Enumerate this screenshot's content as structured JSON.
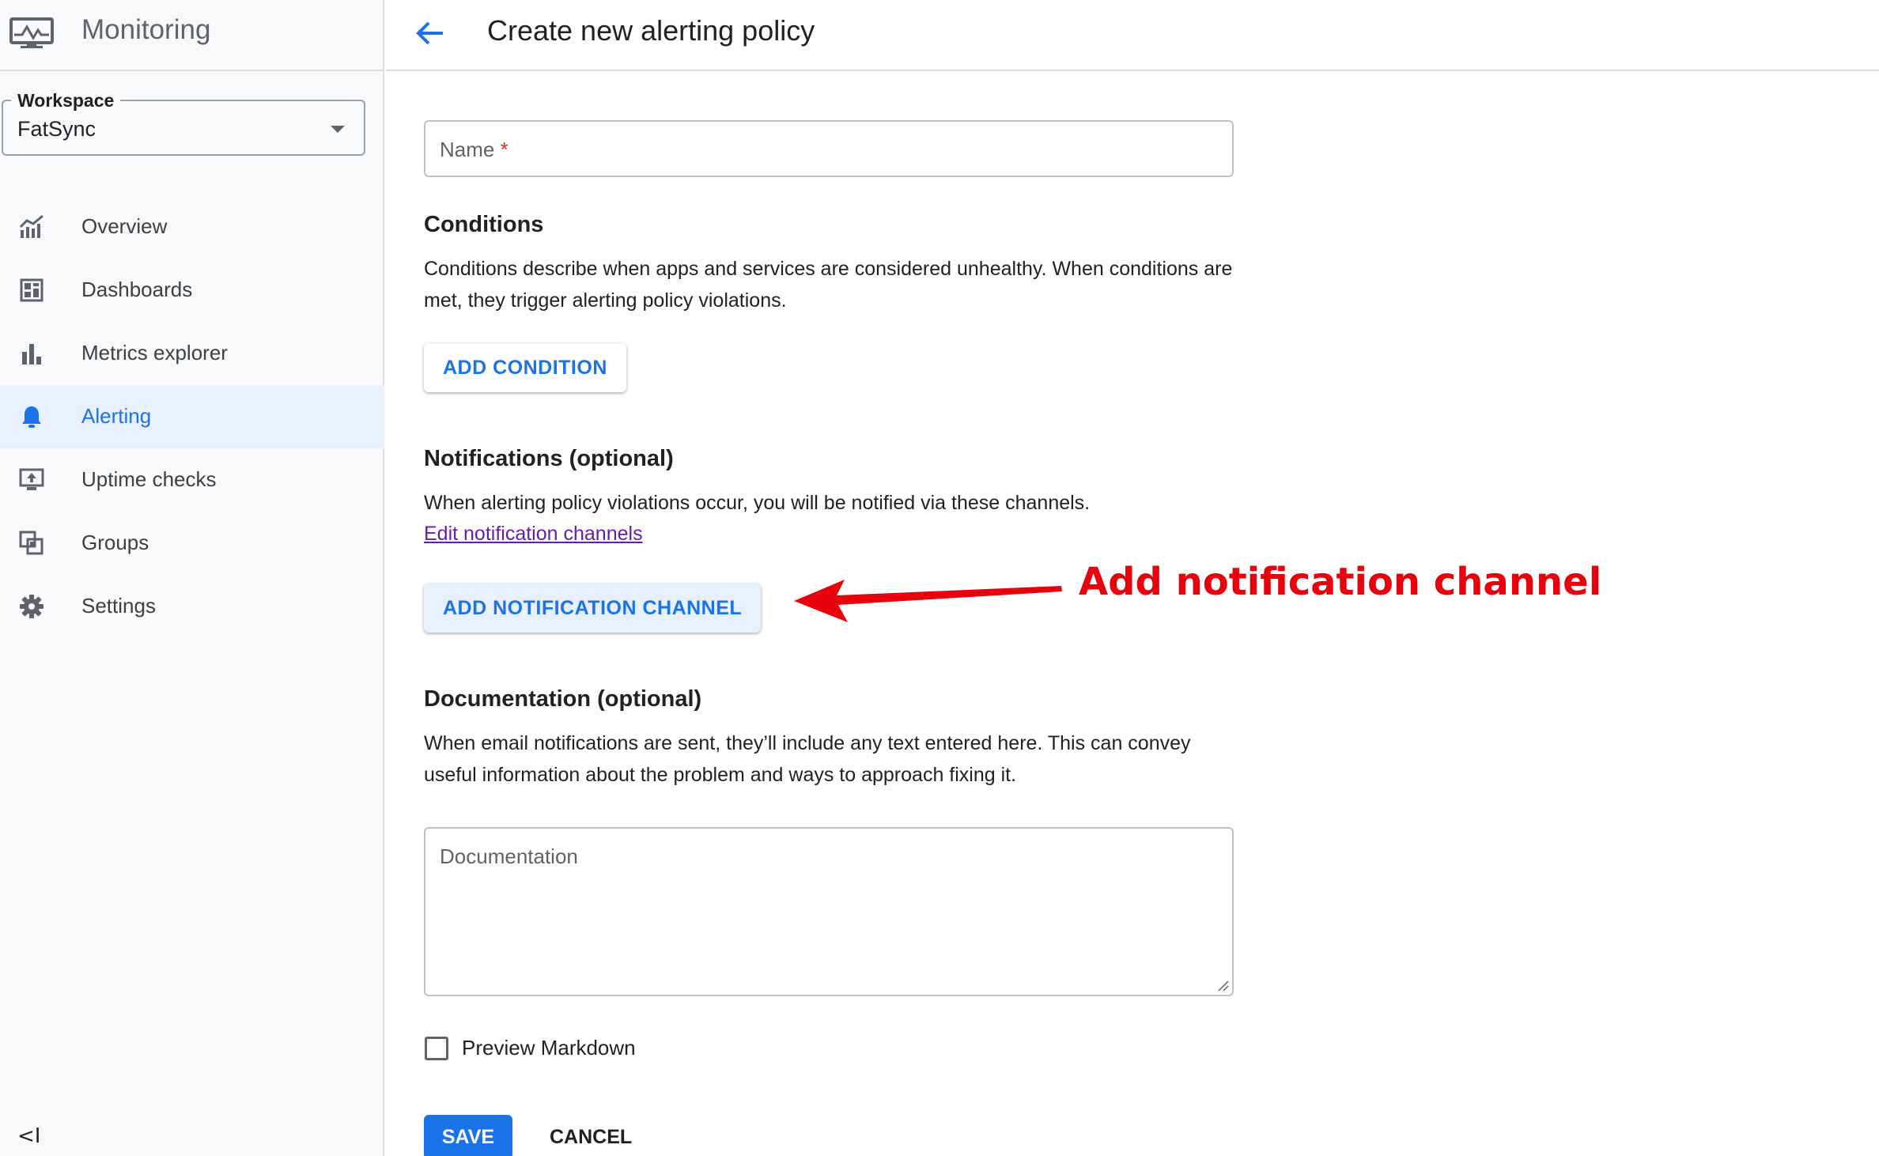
{
  "app": {
    "title": "Monitoring",
    "logo_icon": "monitor-icon"
  },
  "workspace": {
    "label": "Workspace",
    "value": "FatSync"
  },
  "sidebar": {
    "items": [
      {
        "label": "Overview",
        "icon": "overview-chart-icon",
        "active": false
      },
      {
        "label": "Dashboards",
        "icon": "dashboard-icon",
        "active": false
      },
      {
        "label": "Metrics explorer",
        "icon": "bar-chart-icon",
        "active": false
      },
      {
        "label": "Alerting",
        "icon": "bell-icon",
        "active": true
      },
      {
        "label": "Uptime checks",
        "icon": "uptime-monitor-icon",
        "active": false
      },
      {
        "label": "Groups",
        "icon": "groups-icon",
        "active": false
      },
      {
        "label": "Settings",
        "icon": "gear-icon",
        "active": false
      }
    ],
    "collapse_glyph": "<I"
  },
  "header": {
    "title": "Create new alerting policy"
  },
  "form": {
    "name": {
      "placeholder": "Name",
      "required_mark": "*"
    },
    "conditions": {
      "title": "Conditions",
      "description": "Conditions describe when apps and services are considered unhealthy. When conditions are met, they trigger alerting policy violations.",
      "button": "ADD CONDITION"
    },
    "notifications": {
      "title": "Notifications (optional)",
      "description": "When alerting policy violations occur, you will be notified via these channels.",
      "link": "Edit notification channels",
      "button": "ADD NOTIFICATION CHANNEL"
    },
    "documentation": {
      "title": "Documentation (optional)",
      "description": "When email notifications are sent, they’ll include any text entered here. This can convey useful information about the problem and ways to approach fixing it.",
      "placeholder": "Documentation"
    },
    "preview_markdown": {
      "label": "Preview Markdown",
      "checked": false
    },
    "save": "SAVE",
    "cancel": "CANCEL"
  },
  "annotation": {
    "text": "Add notification channel",
    "color": "#e8000d"
  },
  "colors": {
    "accent": "#1a73e8",
    "active_bg": "#e8f0fe",
    "link_visited": "#681da8"
  }
}
